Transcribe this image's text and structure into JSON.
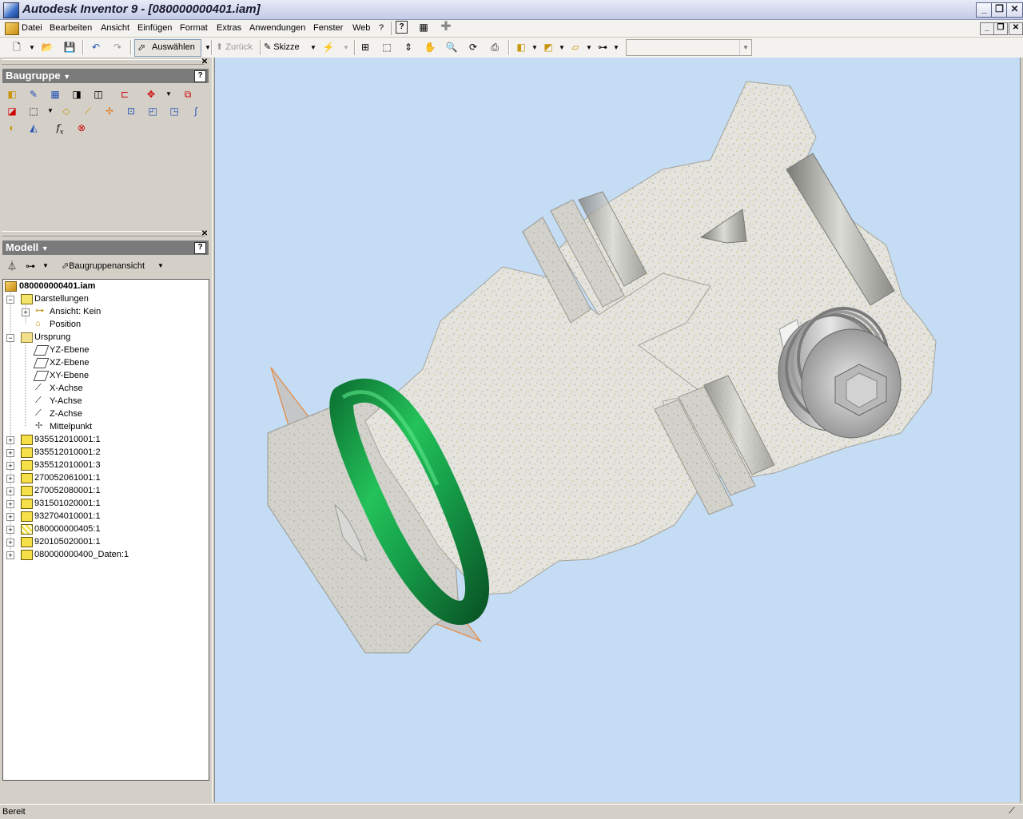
{
  "window": {
    "title": "Autodesk Inventor 9 - [080000000401.iam]"
  },
  "menu": [
    "Datei",
    "Bearbeiten",
    "Ansicht",
    "Einfügen",
    "Format",
    "Extras",
    "Anwendungen",
    "Fenster",
    "Web",
    "?"
  ],
  "toolbar": {
    "select_label": "Auswählen",
    "back_label": "Zurück",
    "sketch_label": "Skizze",
    "combo_value": ""
  },
  "assembly_panel": {
    "title": "Baugruppe",
    "help": "?"
  },
  "model_panel": {
    "title": "Modell",
    "help": "?",
    "view_label": "Baugruppenansicht"
  },
  "tree": {
    "root": "080000000401.iam",
    "darstellungen": "Darstellungen",
    "ansicht": "Ansicht: Kein",
    "position": "Position",
    "ursprung": "Ursprung",
    "origin_items": [
      "YZ-Ebene",
      "XZ-Ebene",
      "XY-Ebene",
      "X-Achse",
      "Y-Achse",
      "Z-Achse",
      "Mittelpunkt"
    ],
    "components": [
      "935512010001:1",
      "935512010001:2",
      "935512010001:3",
      "270052061001:1",
      "270052080001:1",
      "931501020001:1",
      "932704010001:1",
      "080000000405:1",
      "920105020001:1",
      "080000000400_Daten:1"
    ]
  },
  "status": {
    "text": "Bereit"
  },
  "colors": {
    "viewport_bg": "#c4dcf4",
    "oring": "#16a04a",
    "panel_head": "#7a7a7a"
  }
}
